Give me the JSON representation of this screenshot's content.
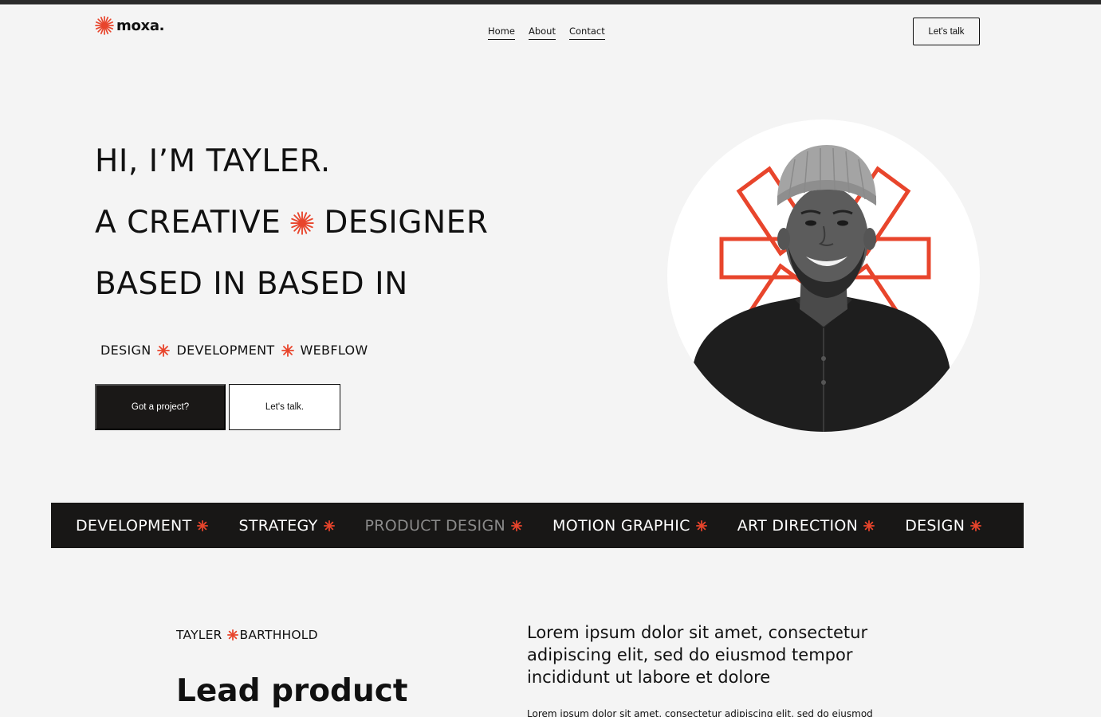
{
  "header": {
    "logo_text": "moxa.",
    "logo_icon": "asterisk-burst-icon",
    "nav": [
      {
        "label": "Home"
      },
      {
        "label": "About"
      },
      {
        "label": "Contact"
      }
    ],
    "cta_label": "Let's talk"
  },
  "hero": {
    "line1": "HI, I’M TAYLER.",
    "line2_before": "A CREATIVE",
    "line2_after": "DESIGNER",
    "line3": "BASED IN BASED IN",
    "skills": [
      "DESIGN",
      "DEVELOPMENT",
      "WEBFLOW"
    ],
    "primary_button": "Got a project?",
    "secondary_button": "Let's talk."
  },
  "marquee": {
    "items": [
      {
        "label": "DEVELOPMENT"
      },
      {
        "label": "STRATEGY"
      },
      {
        "label": "PRODUCT DESIGN"
      },
      {
        "label": "MOTION GRAPHIC"
      },
      {
        "label": "ART DIRECTION"
      },
      {
        "label": "DESIGN"
      }
    ]
  },
  "about": {
    "first_name": "TAYLER",
    "last_name": "BARTHHOLD",
    "role": "Lead product",
    "intro": "Lorem ipsum dolor sit amet, consectetur adipiscing elit, sed do eiusmod tempor incididunt ut labore et dolore",
    "intro_small": "Lorem ipsum dolor sit amet, consectetur adipiscing elit, sed do eiusmod"
  },
  "colors": {
    "accent": "#e8452c",
    "dark": "#181716",
    "background": "#f4f4f4"
  }
}
